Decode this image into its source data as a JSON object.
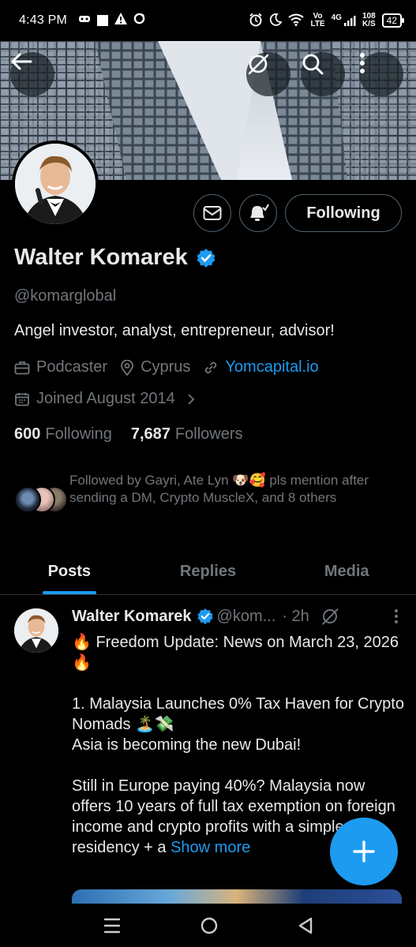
{
  "status_bar": {
    "time": "4:43 PM",
    "battery": "42",
    "net_speed_top": "108",
    "net_speed_bottom": "K/S",
    "volte_top": "Vo",
    "volte_bottom": "LTE",
    "network": "4G"
  },
  "header_icons": [
    "back-arrow-icon",
    "grok-icon",
    "search-icon",
    "more-vertical-icon"
  ],
  "profile": {
    "name": "Walter Komarek",
    "verified": true,
    "handle": "@komarglobal",
    "bio": "Angel investor, analyst, entrepreneur, advisor!",
    "category": "Podcaster",
    "location": "Cyprus",
    "website": "Yomcapital.io",
    "joined": "Joined August 2014",
    "following_count": "600",
    "following_label": "Following",
    "followers_count": "7,687",
    "followers_label": "Followers",
    "followed_by": "Followed by Gayri, Ate Lyn 🐶🥰 pls mention after sending a DM, Crypto MuscleX, and 8 others"
  },
  "actions": {
    "following_button": "Following"
  },
  "tabs": [
    {
      "label": "Posts",
      "active": true
    },
    {
      "label": "Replies",
      "active": false
    },
    {
      "label": "Media",
      "active": false
    }
  ],
  "post": {
    "author": "Walter Komarek",
    "handle_trunc": "@kom...",
    "time": "· 2h",
    "text": "🔥 Freedom Update: News on March 23, 2026 🔥\n\n1. Malaysia Launches 0% Tax Haven for Crypto Nomads 🏝️💸\nAsia is becoming the new Dubai!\n\nStill in Europe paying 40%? Malaysia now offers 10 years of full tax exemption on foreign income and crypto profits with a simple residency + a ",
    "show_more": "Show more"
  },
  "colors": {
    "accent": "#1d9bf0",
    "background": "#000000",
    "muted_text": "#71767b",
    "primary_text": "#e7e9ea",
    "border": "#2f3336"
  }
}
